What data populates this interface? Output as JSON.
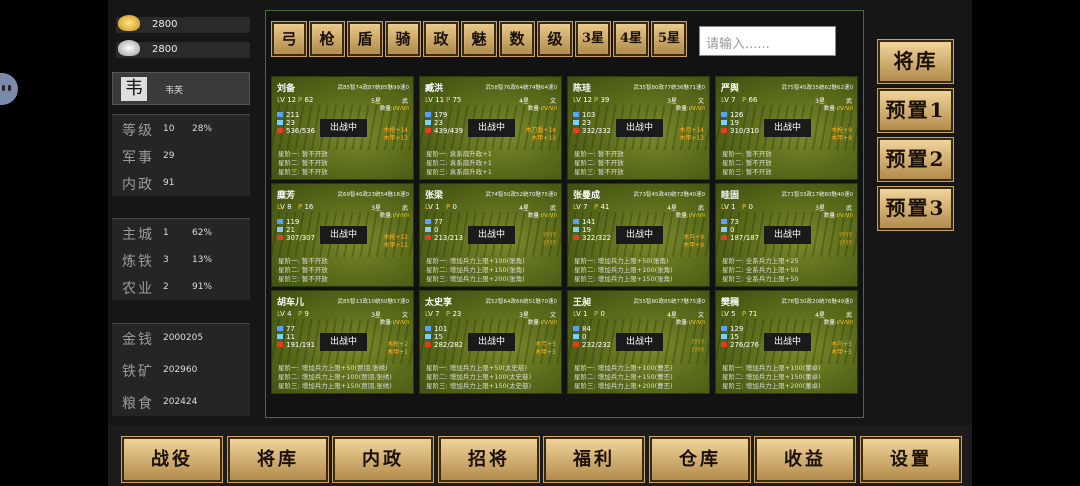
{
  "resources": {
    "gold": "2800",
    "silver": "2800"
  },
  "player": {
    "seal": "韦",
    "name": "韦芙"
  },
  "stats": [
    {
      "label": "等级",
      "value": "10",
      "extra": "28%"
    },
    {
      "label": "军事",
      "value": "29",
      "extra": ""
    },
    {
      "label": "内政",
      "value": "91",
      "extra": ""
    }
  ],
  "stats2": [
    {
      "label": "主城",
      "value": "1",
      "extra": "62%"
    },
    {
      "label": "炼铁",
      "value": "3",
      "extra": "13%"
    },
    {
      "label": "农业",
      "value": "2",
      "extra": "91%"
    }
  ],
  "stats3": [
    {
      "label": "金钱",
      "value": "2000205"
    },
    {
      "label": "铁矿",
      "value": "202960"
    },
    {
      "label": "粮食",
      "value": "202424"
    }
  ],
  "filters": [
    "弓",
    "枪",
    "盾",
    "骑",
    "政",
    "魅",
    "数",
    "级",
    "3星",
    "4星",
    "5星"
  ],
  "search": {
    "placeholder": "请输入......"
  },
  "right_buttons": [
    "将库",
    "预置1",
    "预置2",
    "预置3"
  ],
  "bottom_nav": [
    "战役",
    "将库",
    "内政",
    "招将",
    "福利",
    "仓库",
    "收益",
    "设置"
  ],
  "battle_label": "出战中",
  "qty_label": "数量:",
  "qty_marks": "I/V/V/I",
  "generals": [
    {
      "name": "刘备",
      "attr": "武85智74政87统85魅99速0",
      "lv": "12",
      "cost": "62",
      "star": "5星",
      "type": "武",
      "s1": "211",
      "s2": "23",
      "s3": "536/536",
      "b1": "木枪+14",
      "b2": "木甲+13",
      "t1": "星阶一: 暂不开放",
      "t2": "星阶二: 暂不开放",
      "t3": "星阶三: 暂不开放"
    },
    {
      "name": "臧洪",
      "attr": "武58智76政64统74魅64速0",
      "lv": "11",
      "cost": "75",
      "star": "4星",
      "type": "文",
      "s1": "179",
      "s2": "23",
      "s3": "439/439",
      "b1": "木刀盾+14",
      "b2": "木甲+13",
      "t1": "星阶一: 袁系扇升政+1",
      "t2": "星阶二: 袁系扇升政+1",
      "t3": "星阶三: 袁系扇升政+1"
    },
    {
      "name": "陈珪",
      "attr": "武35智80政77统36魅71速0",
      "lv": "12",
      "cost": "39",
      "star": "3星",
      "type": "文",
      "s1": "103",
      "s2": "23",
      "s3": "332/332",
      "b1": "木弓+14",
      "b2": "木甲+13",
      "t1": "星阶一: 暂不开放",
      "t2": "星阶二: 暂不开放",
      "t3": "星阶三: 暂不开放"
    },
    {
      "name": "严舆",
      "attr": "武75智45政35统62魅62速0",
      "lv": "7",
      "cost": "66",
      "star": "3星",
      "type": "武",
      "s1": "126",
      "s2": "19",
      "s3": "310/310",
      "b1": "木枪+9",
      "b2": "木甲+9",
      "t1": "星阶一: 暂不开放",
      "t2": "星阶二: 暂不开放",
      "t3": "星阶三: 暂不开放"
    },
    {
      "name": "糜芳",
      "attr": "武69智46政23统54魅18速0",
      "lv": "8",
      "cost": "16",
      "star": "3星",
      "type": "武",
      "s1": "119",
      "s2": "21",
      "s3": "307/307",
      "b1": "木枪+12",
      "b2": "木甲+11",
      "t1": "星阶一: 暂不开放",
      "t2": "星阶二: 暂不开放",
      "t3": "星阶三: 暂不开放"
    },
    {
      "name": "张梁",
      "attr": "武74智50政52统70魅75速0",
      "lv": "1",
      "cost": "0",
      "star": "4星",
      "type": "武",
      "s1": "77",
      "s2": "0",
      "s3": "213/213",
      "b1": "????",
      "b2": "????",
      "t1": "星阶一: 增加兵力上限+100(张角)",
      "t2": "星阶二: 增加兵力上限+150(张角)",
      "t3": "星阶三: 增加兵力上限+200(张角)"
    },
    {
      "name": "张曼成",
      "attr": "武73智45政40统72魅40速0",
      "lv": "7",
      "cost": "41",
      "star": "4星",
      "type": "武",
      "s1": "141",
      "s2": "19",
      "s3": "322/322",
      "b1": "木马+9",
      "b2": "木甲+9",
      "t1": "星阶一: 增加兵力上限+50(张角)",
      "t2": "星阶二: 增加兵力上限+100(张角)",
      "t3": "星阶三: 增加兵力上限+150(张角)"
    },
    {
      "name": "眭固",
      "attr": "武71智33政17统60魅40速0",
      "lv": "1",
      "cost": "0",
      "star": "3星",
      "type": "武",
      "s1": "73",
      "s2": "0",
      "s3": "187/187",
      "b1": "????",
      "b2": "????",
      "t1": "星阶一: 全系兵力上限+25",
      "t2": "星阶二: 全系兵力上限+50",
      "t3": "星阶三: 全系兵力上限+50"
    },
    {
      "name": "胡车儿",
      "attr": "武85智13政10统50魅57速0",
      "lv": "4",
      "cost": "9",
      "star": "3星",
      "type": "文",
      "s1": "77",
      "s2": "11",
      "s3": "191/191",
      "b1": "木枪+2",
      "b2": "木甲+1",
      "t1": "星阶一: 增加兵力上限+50(贾诩,张绣)",
      "t2": "星阶二: 增加兵力上限+100(贾诩,张绣)",
      "t3": "星阶三: 增加兵力上限+150(贾诩,张绣)"
    },
    {
      "name": "太史享",
      "attr": "武52智64政66统51魅70速0",
      "lv": "7",
      "cost": "23",
      "star": "3星",
      "type": "文",
      "s1": "101",
      "s2": "15",
      "s3": "282/282",
      "b1": "木弓+5",
      "b2": "木甲+5",
      "t1": "星阶一: 增加兵力上限+50(太史慈)",
      "t2": "星阶二: 增加兵力上限+100(太史慈)",
      "t3": "星阶三: 增加兵力上限+150(太史慈)"
    },
    {
      "name": "王昶",
      "attr": "武55智80政85统77魅75速0",
      "lv": "1",
      "cost": "0",
      "star": "4星",
      "type": "文",
      "s1": "84",
      "s2": "0",
      "s3": "232/232",
      "b1": "????",
      "b2": "????",
      "t1": "星阶一: 增加兵力上限+100(曹丕)",
      "t2": "星阶二: 增加兵力上限+150(曹丕)",
      "t3": "星阶三: 增加兵力上限+200(曹丕)"
    },
    {
      "name": "樊稠",
      "attr": "武78智30政20统76魅49速0",
      "lv": "5",
      "cost": "71",
      "star": "4星",
      "type": "武",
      "s1": "129",
      "s2": "15",
      "s3": "276/276",
      "b1": "木马+5",
      "b2": "木甲+5",
      "t1": "星阶一: 增加兵力上限+100(董卓)",
      "t2": "星阶二: 增加兵力上限+150(董卓)",
      "t3": "星阶三: 增加兵力上限+200(董卓)"
    }
  ]
}
